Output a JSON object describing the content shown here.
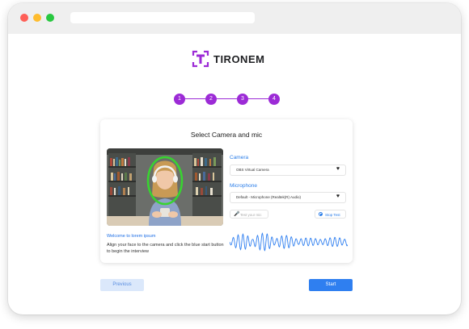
{
  "brand": {
    "name": "TIRONEM",
    "accent": "#9c2bd6"
  },
  "stepper": {
    "steps": [
      "1",
      "2",
      "3",
      "4"
    ]
  },
  "card": {
    "title": "Select Camera and mic",
    "welcome": "Welcome to lorem ipsum",
    "instructions": "Align your face to the camera and click the blue start button to begin the interview"
  },
  "camera": {
    "label": "Camera",
    "value": "OBS Virtual Camera"
  },
  "microphone": {
    "label": "Microphone",
    "value": "Default - Microphone (Realtek(R) Audio)"
  },
  "controls": {
    "test_mic": "Test your mic",
    "stop_test": "Stop Test"
  },
  "icons": {
    "dropdown": "heart-icon",
    "mic": "microphone-icon",
    "stop": "stop-circle-icon"
  },
  "footer": {
    "previous": "Previous",
    "start": "Start"
  },
  "colors": {
    "primary": "#2f7ff0",
    "face_ring": "#38d430",
    "label_blue": "#2a7de8"
  }
}
